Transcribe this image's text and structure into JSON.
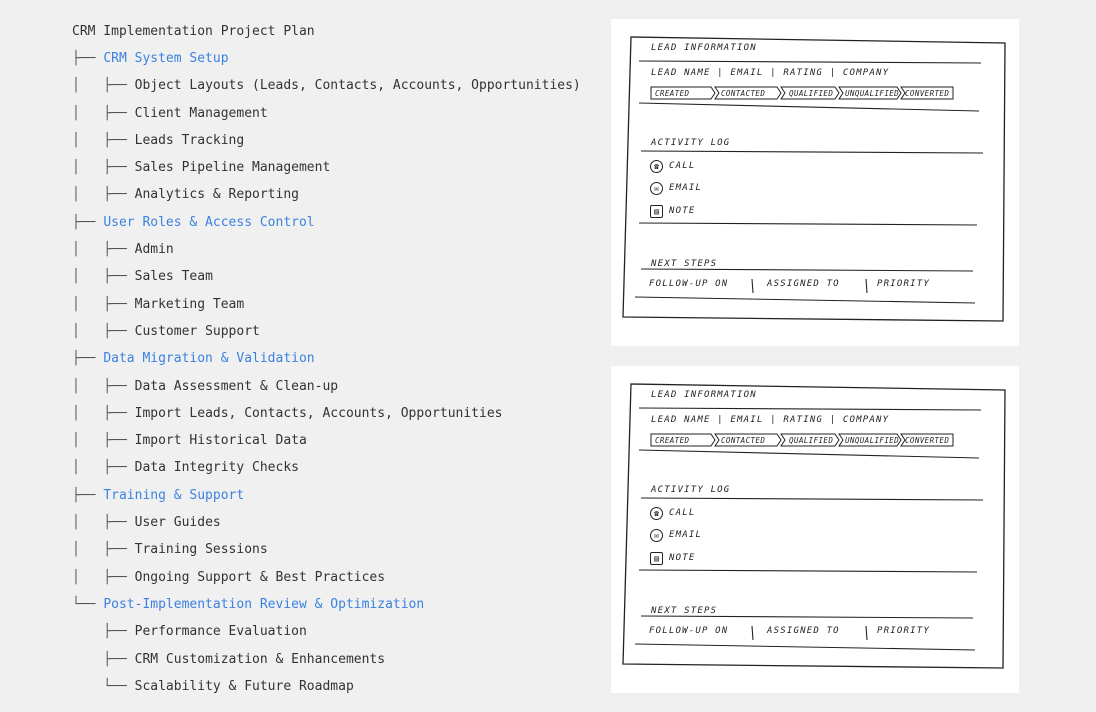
{
  "plan": {
    "title": "CRM Implementation Project Plan",
    "lines": [
      {
        "prefix": "├── ",
        "label": "CRM System Setup",
        "kind": "section"
      },
      {
        "prefix": "│   ├── ",
        "label": "Object Layouts (Leads, Contacts, Accounts, Opportunities)",
        "kind": "item"
      },
      {
        "prefix": "│   ├── ",
        "label": "Client Management",
        "kind": "item"
      },
      {
        "prefix": "│   ├── ",
        "label": "Leads Tracking",
        "kind": "item"
      },
      {
        "prefix": "│   ├── ",
        "label": "Sales Pipeline Management",
        "kind": "item"
      },
      {
        "prefix": "│   ├── ",
        "label": "Analytics & Reporting",
        "kind": "item"
      },
      {
        "prefix": "├── ",
        "label": "User Roles & Access Control",
        "kind": "section"
      },
      {
        "prefix": "│   ├── ",
        "label": "Admin",
        "kind": "item"
      },
      {
        "prefix": "│   ├── ",
        "label": "Sales Team",
        "kind": "item"
      },
      {
        "prefix": "│   ├── ",
        "label": "Marketing Team",
        "kind": "item"
      },
      {
        "prefix": "│   ├── ",
        "label": "Customer Support",
        "kind": "item"
      },
      {
        "prefix": "├── ",
        "label": "Data Migration & Validation",
        "kind": "section"
      },
      {
        "prefix": "│   ├── ",
        "label": "Data Assessment & Clean-up",
        "kind": "item"
      },
      {
        "prefix": "│   ├── ",
        "label": "Import Leads, Contacts, Accounts, Opportunities",
        "kind": "item"
      },
      {
        "prefix": "│   ├── ",
        "label": "Import Historical Data",
        "kind": "item"
      },
      {
        "prefix": "│   ├── ",
        "label": "Data Integrity Checks",
        "kind": "item"
      },
      {
        "prefix": "├── ",
        "label": "Training & Support",
        "kind": "section"
      },
      {
        "prefix": "│   ├── ",
        "label": "User Guides",
        "kind": "item"
      },
      {
        "prefix": "│   ├── ",
        "label": "Training Sessions",
        "kind": "item"
      },
      {
        "prefix": "│   ├── ",
        "label": "Ongoing Support & Best Practices",
        "kind": "item"
      },
      {
        "prefix": "└── ",
        "label": "Post-Implementation Review & Optimization",
        "kind": "section"
      },
      {
        "prefix": "    ├── ",
        "label": "Performance Evaluation",
        "kind": "item"
      },
      {
        "prefix": "    ├── ",
        "label": "CRM Customization & Enhancements",
        "kind": "item"
      },
      {
        "prefix": "    └── ",
        "label": "Scalability & Future Roadmap",
        "kind": "item"
      }
    ]
  },
  "wireframe": {
    "lead_header": "LEAD INFORMATION",
    "lead_fields": "LEAD NAME | EMAIL | RATING | COMPANY",
    "stages": [
      "CREATED",
      "CONTACTED",
      "QUALIFIED",
      "UNQUALIFIED",
      "CONVERTED"
    ],
    "activity_header": "ACTIVITY LOG",
    "activities": [
      {
        "icon": "phone-icon",
        "glyph": "☎",
        "label": "CALL"
      },
      {
        "icon": "mail-icon",
        "glyph": "✉",
        "label": "EMAIL"
      },
      {
        "icon": "note-icon",
        "glyph": "▤",
        "label": "NOTE"
      }
    ],
    "next_header": "NEXT STEPS",
    "next_fields": [
      "FOLLOW-UP ON",
      "ASSIGNED TO",
      "PRIORITY"
    ]
  },
  "colors": {
    "background": "#f0f0f0",
    "section_link": "#3b82e0",
    "text": "#333333",
    "card": "#ffffff"
  }
}
